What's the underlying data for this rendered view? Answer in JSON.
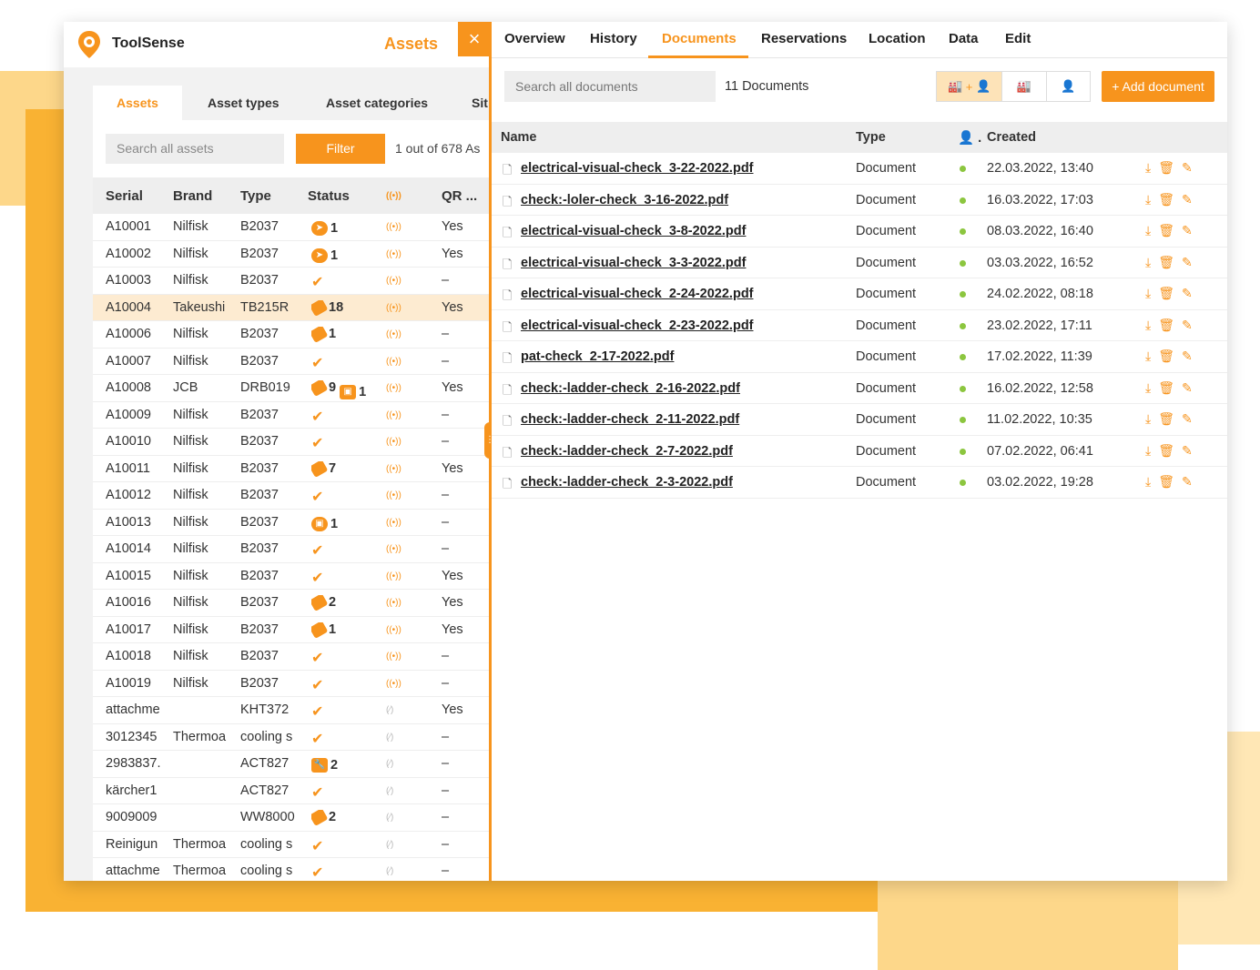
{
  "app": {
    "brand": "ToolSense",
    "panel_title": "Assets",
    "close_icon": "×"
  },
  "left_tabs": [
    "Assets",
    "Asset types",
    "Asset categories",
    "Sit"
  ],
  "left_search": {
    "placeholder": "Search all assets"
  },
  "filter_label": "Filter",
  "left_count": "1 out of 678 As",
  "left_headers": {
    "serial": "Serial",
    "brand": "Brand",
    "type": "Type",
    "status": "Status",
    "qr": "QR ..."
  },
  "assets": [
    {
      "serial": "A10001",
      "brand": "Nilfisk",
      "type": "B2037",
      "status": "badge",
      "badge_icon": "compass",
      "badge_count": "1",
      "rf": "on",
      "qr": "Yes"
    },
    {
      "serial": "A10002",
      "brand": "Nilfisk",
      "type": "B2037",
      "status": "badge",
      "badge_icon": "compass",
      "badge_count": "1",
      "rf": "on",
      "qr": "Yes"
    },
    {
      "serial": "A10003",
      "brand": "Nilfisk",
      "type": "B2037",
      "status": "ok",
      "rf": "on",
      "qr": "–"
    },
    {
      "serial": "A10004",
      "brand": "Takeushi",
      "type": "TB215R",
      "status": "badge",
      "badge_icon": "tag",
      "badge_count": "18",
      "rf": "on",
      "qr": "Yes",
      "highlight": true
    },
    {
      "serial": "A10006",
      "brand": "Nilfisk",
      "type": "B2037",
      "status": "badge",
      "badge_icon": "tag",
      "badge_count": "1",
      "rf": "on",
      "qr": "–"
    },
    {
      "serial": "A10007",
      "brand": "Nilfisk",
      "type": "B2037",
      "status": "ok",
      "rf": "on",
      "qr": "–"
    },
    {
      "serial": "A10008",
      "brand": "JCB",
      "type": "DRB019",
      "status": "badge2",
      "badge_icon": "tag",
      "badge_count": "9",
      "badge2_count": "1",
      "rf": "on",
      "qr": "Yes"
    },
    {
      "serial": "A10009",
      "brand": "Nilfisk",
      "type": "B2037",
      "status": "ok",
      "rf": "on",
      "qr": "–"
    },
    {
      "serial": "A10010",
      "brand": "Nilfisk",
      "type": "B2037",
      "status": "ok",
      "rf": "on",
      "qr": "–"
    },
    {
      "serial": "A10011",
      "brand": "Nilfisk",
      "type": "B2037",
      "status": "badge",
      "badge_icon": "tag",
      "badge_count": "7",
      "rf": "on",
      "qr": "Yes"
    },
    {
      "serial": "A10012",
      "brand": "Nilfisk",
      "type": "B2037",
      "status": "ok",
      "rf": "on",
      "qr": "–"
    },
    {
      "serial": "A10013",
      "brand": "Nilfisk",
      "type": "B2037",
      "status": "badge",
      "badge_icon": "robot",
      "badge_count": "1",
      "rf": "on",
      "qr": "–"
    },
    {
      "serial": "A10014",
      "brand": "Nilfisk",
      "type": "B2037",
      "status": "ok",
      "rf": "on",
      "qr": "–"
    },
    {
      "serial": "A10015",
      "brand": "Nilfisk",
      "type": "B2037",
      "status": "ok",
      "rf": "on",
      "qr": "Yes"
    },
    {
      "serial": "A10016",
      "brand": "Nilfisk",
      "type": "B2037",
      "status": "badge",
      "badge_icon": "tag",
      "badge_count": "2",
      "rf": "on",
      "qr": "Yes"
    },
    {
      "serial": "A10017",
      "brand": "Nilfisk",
      "type": "B2037",
      "status": "badge",
      "badge_icon": "tag",
      "badge_count": "1",
      "rf": "on",
      "qr": "Yes"
    },
    {
      "serial": "A10018",
      "brand": "Nilfisk",
      "type": "B2037",
      "status": "ok",
      "rf": "on",
      "qr": "–"
    },
    {
      "serial": "A10019",
      "brand": "Nilfisk",
      "type": "B2037",
      "status": "ok",
      "rf": "on",
      "qr": "–"
    },
    {
      "serial": "attachme",
      "brand": "",
      "type": "KHT372",
      "status": "ok",
      "rf": "off",
      "qr": "Yes"
    },
    {
      "serial": "3012345",
      "brand": "Thermoa",
      "type": "cooling s",
      "status": "ok",
      "rf": "off",
      "qr": "–"
    },
    {
      "serial": "2983837.",
      "brand": "",
      "type": "ACT827",
      "status": "badge",
      "badge_icon": "wrench",
      "badge_count": "2",
      "rf": "off",
      "qr": "–"
    },
    {
      "serial": "kärcher1",
      "brand": "",
      "type": "ACT827",
      "status": "ok",
      "rf": "off",
      "qr": "–"
    },
    {
      "serial": "9009009",
      "brand": "",
      "type": "WW8000",
      "status": "badge",
      "badge_icon": "tag",
      "badge_count": "2",
      "rf": "off",
      "qr": "–"
    },
    {
      "serial": "Reinigun",
      "brand": "Thermoa",
      "type": "cooling s",
      "status": "ok",
      "rf": "off",
      "qr": "–"
    },
    {
      "serial": "attachme",
      "brand": "Thermoa",
      "type": "cooling s",
      "status": "ok",
      "rf": "off",
      "qr": "–"
    }
  ],
  "right_tabs": [
    "Overview",
    "History",
    "Documents",
    "Reservations",
    "Location",
    "Data",
    "Edit"
  ],
  "right_active_tab": "Documents",
  "doc_search": {
    "placeholder": "Search all documents"
  },
  "doc_count": "11 Documents",
  "add_document": "+ Add document",
  "doc_headers": {
    "name": "Name",
    "type": "Type",
    "owner": "",
    "created": "Created"
  },
  "documents": [
    {
      "name": "electrical-visual-check_3-22-2022.pdf",
      "type": "Document",
      "created": "22.03.2022, 13:40"
    },
    {
      "name": "check:-loler-check_3-16-2022.pdf",
      "type": "Document",
      "created": "16.03.2022, 17:03"
    },
    {
      "name": "electrical-visual-check_3-8-2022.pdf",
      "type": "Document",
      "created": "08.03.2022, 16:40"
    },
    {
      "name": "electrical-visual-check_3-3-2022.pdf",
      "type": "Document",
      "created": "03.03.2022, 16:52"
    },
    {
      "name": "electrical-visual-check_2-24-2022.pdf",
      "type": "Document",
      "created": "24.02.2022, 08:18"
    },
    {
      "name": "electrical-visual-check_2-23-2022.pdf",
      "type": "Document",
      "created": "23.02.2022, 17:11"
    },
    {
      "name": "pat-check_2-17-2022.pdf",
      "type": "Document",
      "created": "17.02.2022, 11:39"
    },
    {
      "name": "check:-ladder-check_2-16-2022.pdf",
      "type": "Document",
      "created": "16.02.2022, 12:58"
    },
    {
      "name": "check:-ladder-check_2-11-2022.pdf",
      "type": "Document",
      "created": "11.02.2022, 10:35"
    },
    {
      "name": "check:-ladder-check_2-7-2022.pdf",
      "type": "Document",
      "created": "07.02.2022, 06:41"
    },
    {
      "name": "check:-ladder-check_2-3-2022.pdf",
      "type": "Document",
      "created": "03.02.2022, 19:28"
    }
  ],
  "colors": {
    "accent": "#f7941d",
    "status_dot": "#8cc63f"
  }
}
